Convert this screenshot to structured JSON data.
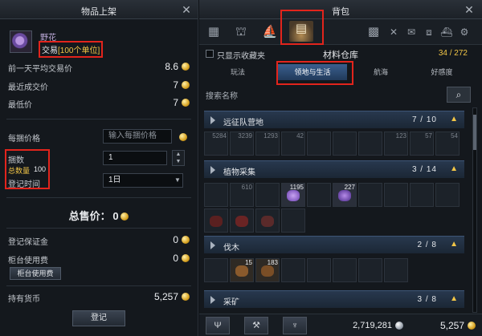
{
  "left": {
    "title": "物品上架",
    "item": {
      "name": "野花",
      "trade_prefix": "交易",
      "trade_unit": "[100个单位]"
    },
    "stats": [
      {
        "label": "前一天平均交易价",
        "value": "8.6"
      },
      {
        "label": "最近成交价",
        "value": "7"
      },
      {
        "label": "最低价",
        "value": "7"
      }
    ],
    "unit_price_label": "每捆价格",
    "unit_price_placeholder": "输入每捆价格",
    "bundle_label": "捆数",
    "bundle_value": "1",
    "total_qty_label": "总数量",
    "total_qty_value": "100",
    "reg_time_label": "登记时间",
    "reg_time_value": "1日",
    "total_price_label": "总售价：",
    "total_price_value": "0",
    "deposit_label": "登记保证金",
    "deposit_value": "0",
    "fee_label": "柜台使用费",
    "fee_value": "0",
    "fee_button": "柜台使用费",
    "money_label": "持有货币",
    "money_value": "5,257",
    "register_button": "登记"
  },
  "right": {
    "title": "背包",
    "show_fav_label": "只显示收藏夹",
    "warehouse_title": "材料仓库",
    "capacity": "34 / 272",
    "subtabs": [
      "玩法",
      "领地与生活",
      "航海",
      "好感度"
    ],
    "search_label": "搜索名称",
    "categories": [
      {
        "name": "远征队营地",
        "count": "7 / 10",
        "slots": [
          "5284",
          "3239",
          "1293",
          "42",
          "",
          "",
          "",
          "123",
          "57",
          "54"
        ]
      },
      {
        "name": "植物采集",
        "count": "3 / 14",
        "slots": [
          "",
          "610",
          "",
          "1195",
          "",
          "227",
          "",
          "",
          "",
          "",
          "",
          "",
          "",
          ""
        ]
      },
      {
        "name": "伐木",
        "count": "2 / 8",
        "slots": [
          "",
          "15",
          "183",
          "",
          "",
          "",
          "",
          ""
        ]
      },
      {
        "name": "采矿",
        "count": "3 / 8"
      }
    ],
    "silver": "2,719,281",
    "gold": "5,257"
  }
}
